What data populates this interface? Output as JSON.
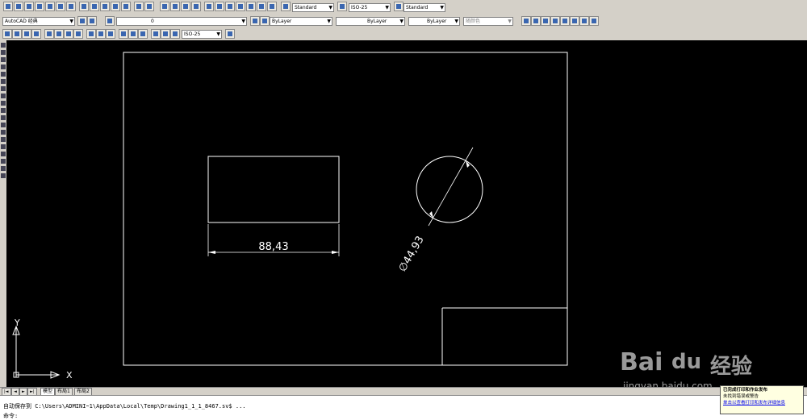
{
  "toolbar2": {
    "workspace": "AutoCAD 经典",
    "layer": "0"
  },
  "styles": {
    "text_style": "Standard",
    "dim_style": "ISO-25",
    "table_style": "Standard"
  },
  "properties": {
    "color": "ByLayer",
    "linetype": "ByLayer",
    "lineweight": "ByLayer",
    "plotstyle": "随颜色"
  },
  "toolbar3": {
    "dim_style": "ISO-25"
  },
  "drawing": {
    "dim_linear": "88,43",
    "dim_diameter": "∅44,93"
  },
  "ucs": {
    "x_label": "X",
    "y_label": "Y"
  },
  "tabs": [
    "模型",
    "布局1",
    "布局2"
  ],
  "command": {
    "history": "自动保存到 C:\\Users\\ADMINI~1\\AppData\\Local\\Temp\\Drawing1_1_1_8467.sv$ ...",
    "prompt": "命令:"
  },
  "notification": {
    "title": "已完成打印和作业发布",
    "line1": "未找到错误或警告",
    "link": "单击以查看打印和发布详细信息"
  },
  "watermark": {
    "brand": "Bai",
    "brand2": "du",
    "suffix": "经验",
    "url": "jingyan.baidu.com"
  }
}
